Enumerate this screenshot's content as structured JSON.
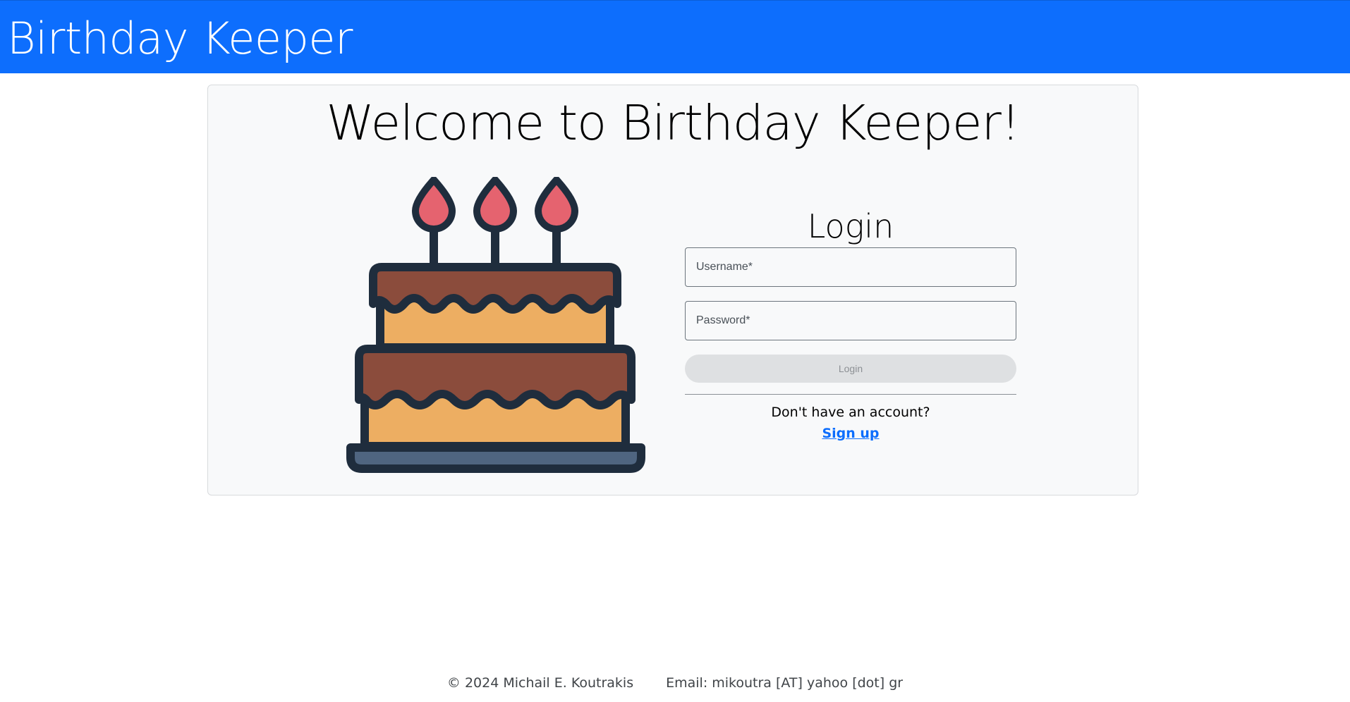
{
  "navbar": {
    "brand": "Birthday Keeper"
  },
  "main": {
    "welcome_title": "Welcome to Birthday Keeper!",
    "login": {
      "title": "Login",
      "username_placeholder": "Username*",
      "password_placeholder": "Password*",
      "submit_label": "Login",
      "no_account_text": "Don't have an account?",
      "signup_link": "Sign up"
    }
  },
  "footer": {
    "copyright": "© 2024 Michail E. Koutrakis",
    "email": "Email: mikoutra [AT] yahoo [dot] gr"
  },
  "colors": {
    "navbar_bg": "#0d6efd",
    "link": "#0d6efd",
    "cake_outline": "#1f2d3d",
    "cake_chocolate": "#8b4c3c",
    "cake_sponge": "#edae62",
    "cake_plate": "#4f6580",
    "candle_flame": "#e5636f"
  },
  "icons": {
    "illustration": "birthday-cake-icon"
  }
}
